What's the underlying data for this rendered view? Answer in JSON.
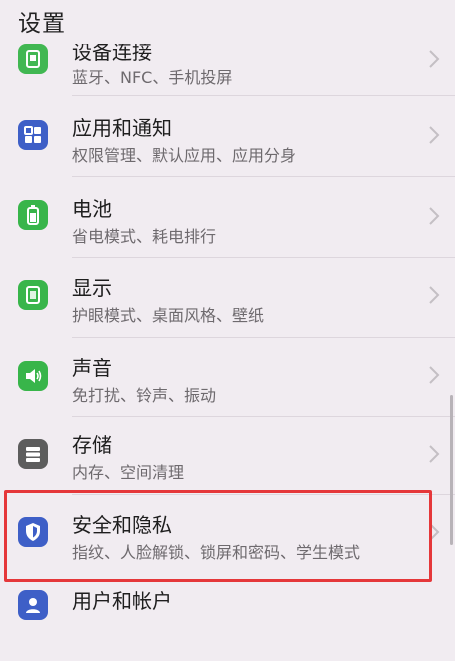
{
  "header": {
    "title": "设置"
  },
  "items": [
    {
      "label": "设备连接",
      "sub": "蓝牙、NFC、手机投屏",
      "icon": "device-connection-icon",
      "color": "#38b54a"
    },
    {
      "label": "应用和通知",
      "sub": "权限管理、默认应用、应用分身",
      "icon": "apps-grid-icon",
      "color": "#3e5fc7"
    },
    {
      "label": "电池",
      "sub": "省电模式、耗电排行",
      "icon": "battery-icon",
      "color": "#38b54a"
    },
    {
      "label": "显示",
      "sub": "护眼模式、桌面风格、壁纸",
      "icon": "display-icon",
      "color": "#38b54a"
    },
    {
      "label": "声音",
      "sub": "免打扰、铃声、振动",
      "icon": "speaker-icon",
      "color": "#38b54a"
    },
    {
      "label": "存储",
      "sub": "内存、空间清理",
      "icon": "storage-icon",
      "color": "#5d5d5d"
    },
    {
      "label": "安全和隐私",
      "sub": "指纹、人脸解锁、锁屏和密码、学生模式",
      "icon": "shield-icon",
      "color": "#3e5fc7"
    },
    {
      "label": "用户和帐户",
      "sub": "",
      "icon": "user-icon",
      "color": "#3e5fc7"
    }
  ],
  "highlight_color": "#e5373a"
}
